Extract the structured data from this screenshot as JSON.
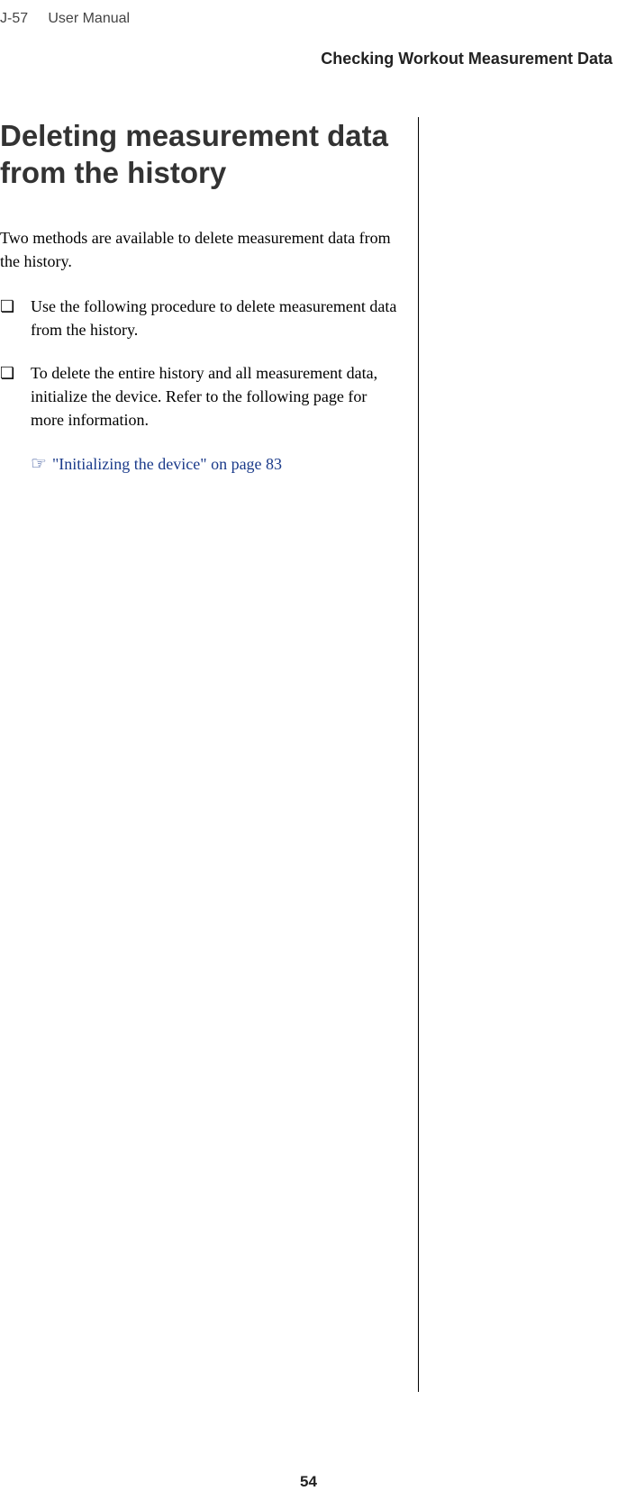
{
  "header": {
    "model": "J-57",
    "manual_label": "User Manual",
    "chapter": "Checking Workout Measurement Data"
  },
  "main": {
    "title": "Deleting measurement data from the history",
    "intro": "Two methods are available to delete measurement data from the history.",
    "items": [
      {
        "text": "Use the following procedure to delete measurement data from the history."
      },
      {
        "text": "To delete the entire history and all measurement data, initialize the device. Refer to the following page for more information."
      }
    ],
    "reference": {
      "icon": "☞",
      "text": "\"Initializing the device\" on page 83"
    }
  },
  "page_number": "54"
}
